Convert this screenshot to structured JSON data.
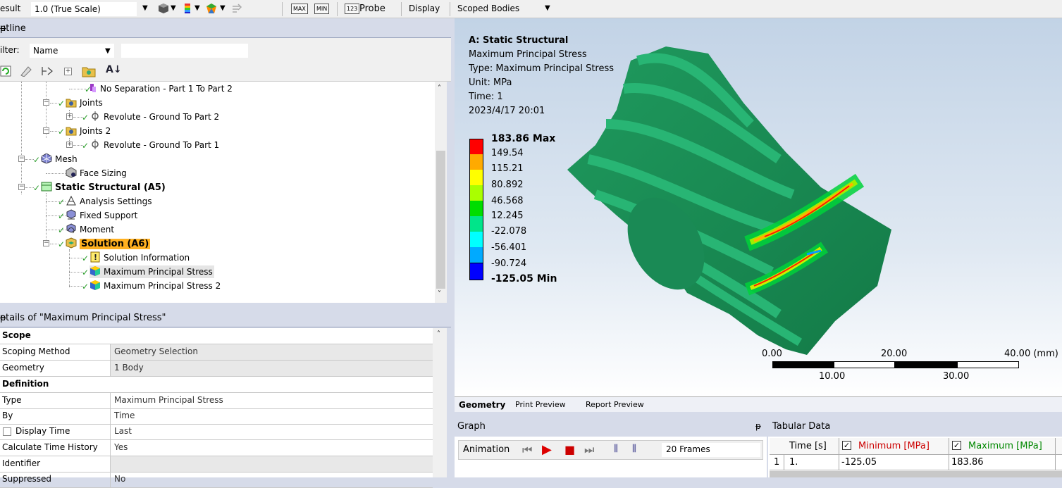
{
  "toolbar": {
    "result_label": "esult",
    "result_value": "1.0 (True Scale)",
    "probe_label": "Probe",
    "display_label": "Display",
    "display_value": "Scoped Bodies",
    "max_btn": "MAX",
    "min_btn": "MIN",
    "probe_btn": "123"
  },
  "outline": {
    "title": "utline",
    "filter_label": "ilter:",
    "filter_value": "Name",
    "tree": [
      {
        "label": "No Separation - Part 1 To Part 2"
      },
      {
        "label": "Joints"
      },
      {
        "label": "Revolute - Ground To Part 2"
      },
      {
        "label": "Joints 2"
      },
      {
        "label": "Revolute - Ground To Part 1"
      },
      {
        "label": "Mesh"
      },
      {
        "label": "Face Sizing"
      },
      {
        "label": "Static Structural (A5)"
      },
      {
        "label": "Analysis Settings"
      },
      {
        "label": "Fixed Support"
      },
      {
        "label": "Moment"
      },
      {
        "label": "Solution (A6)"
      },
      {
        "label": "Solution Information"
      },
      {
        "label": "Maximum Principal Stress"
      },
      {
        "label": "Maximum Principal Stress 2"
      }
    ]
  },
  "details": {
    "title": "etails of \"Maximum Principal Stress\"",
    "rows": [
      {
        "key": "Scope",
        "value": ""
      },
      {
        "key": "Scoping Method",
        "value": "Geometry Selection"
      },
      {
        "key": "Geometry",
        "value": "1 Body"
      },
      {
        "key": "Definition",
        "value": ""
      },
      {
        "key": "Type",
        "value": "Maximum Principal Stress"
      },
      {
        "key": "By",
        "value": "Time"
      },
      {
        "key": "Display Time",
        "value": "Last"
      },
      {
        "key": "Calculate Time History",
        "value": "Yes"
      },
      {
        "key": "Identifier",
        "value": ""
      },
      {
        "key": "Suppressed",
        "value": "No"
      }
    ]
  },
  "viewport": {
    "info": {
      "title": "A: Static Structural",
      "result": "Maximum Principal Stress",
      "type": "Type: Maximum Principal Stress",
      "unit": "Unit: MPa",
      "time": "Time: 1",
      "date": "2023/4/17 20:01"
    },
    "legend": [
      {
        "label": "183.86 Max",
        "color": "#ff0000"
      },
      {
        "label": "149.54",
        "color": "#ffaa00"
      },
      {
        "label": "115.21",
        "color": "#ffff00"
      },
      {
        "label": "80.892",
        "color": "#aaff00"
      },
      {
        "label": "46.568",
        "color": "#00dd00"
      },
      {
        "label": "12.245",
        "color": "#00e58a"
      },
      {
        "label": "-22.078",
        "color": "#00ffff"
      },
      {
        "label": "-56.401",
        "color": "#00aaff"
      },
      {
        "label": "-90.724",
        "color": "#0055ff"
      },
      {
        "label": "-125.05 Min",
        "color": "#0000ff"
      }
    ],
    "scale": {
      "t0": "0.00",
      "t20": "20.00",
      "t40": "40.00 (mm)",
      "t10": "10.00",
      "t30": "30.00"
    },
    "tabs": [
      "Geometry",
      "Print Preview",
      "Report Preview"
    ]
  },
  "graph": {
    "title": "Graph",
    "animation_label": "Animation",
    "frames": "20 Frames"
  },
  "tabular": {
    "title": "Tabular Data",
    "headers": [
      "Time [s]",
      "Minimum [MPa]",
      "Maximum [MPa]"
    ],
    "row": {
      "index": "1",
      "time": "1.",
      "min": "-125.05",
      "max": "183.86"
    }
  }
}
